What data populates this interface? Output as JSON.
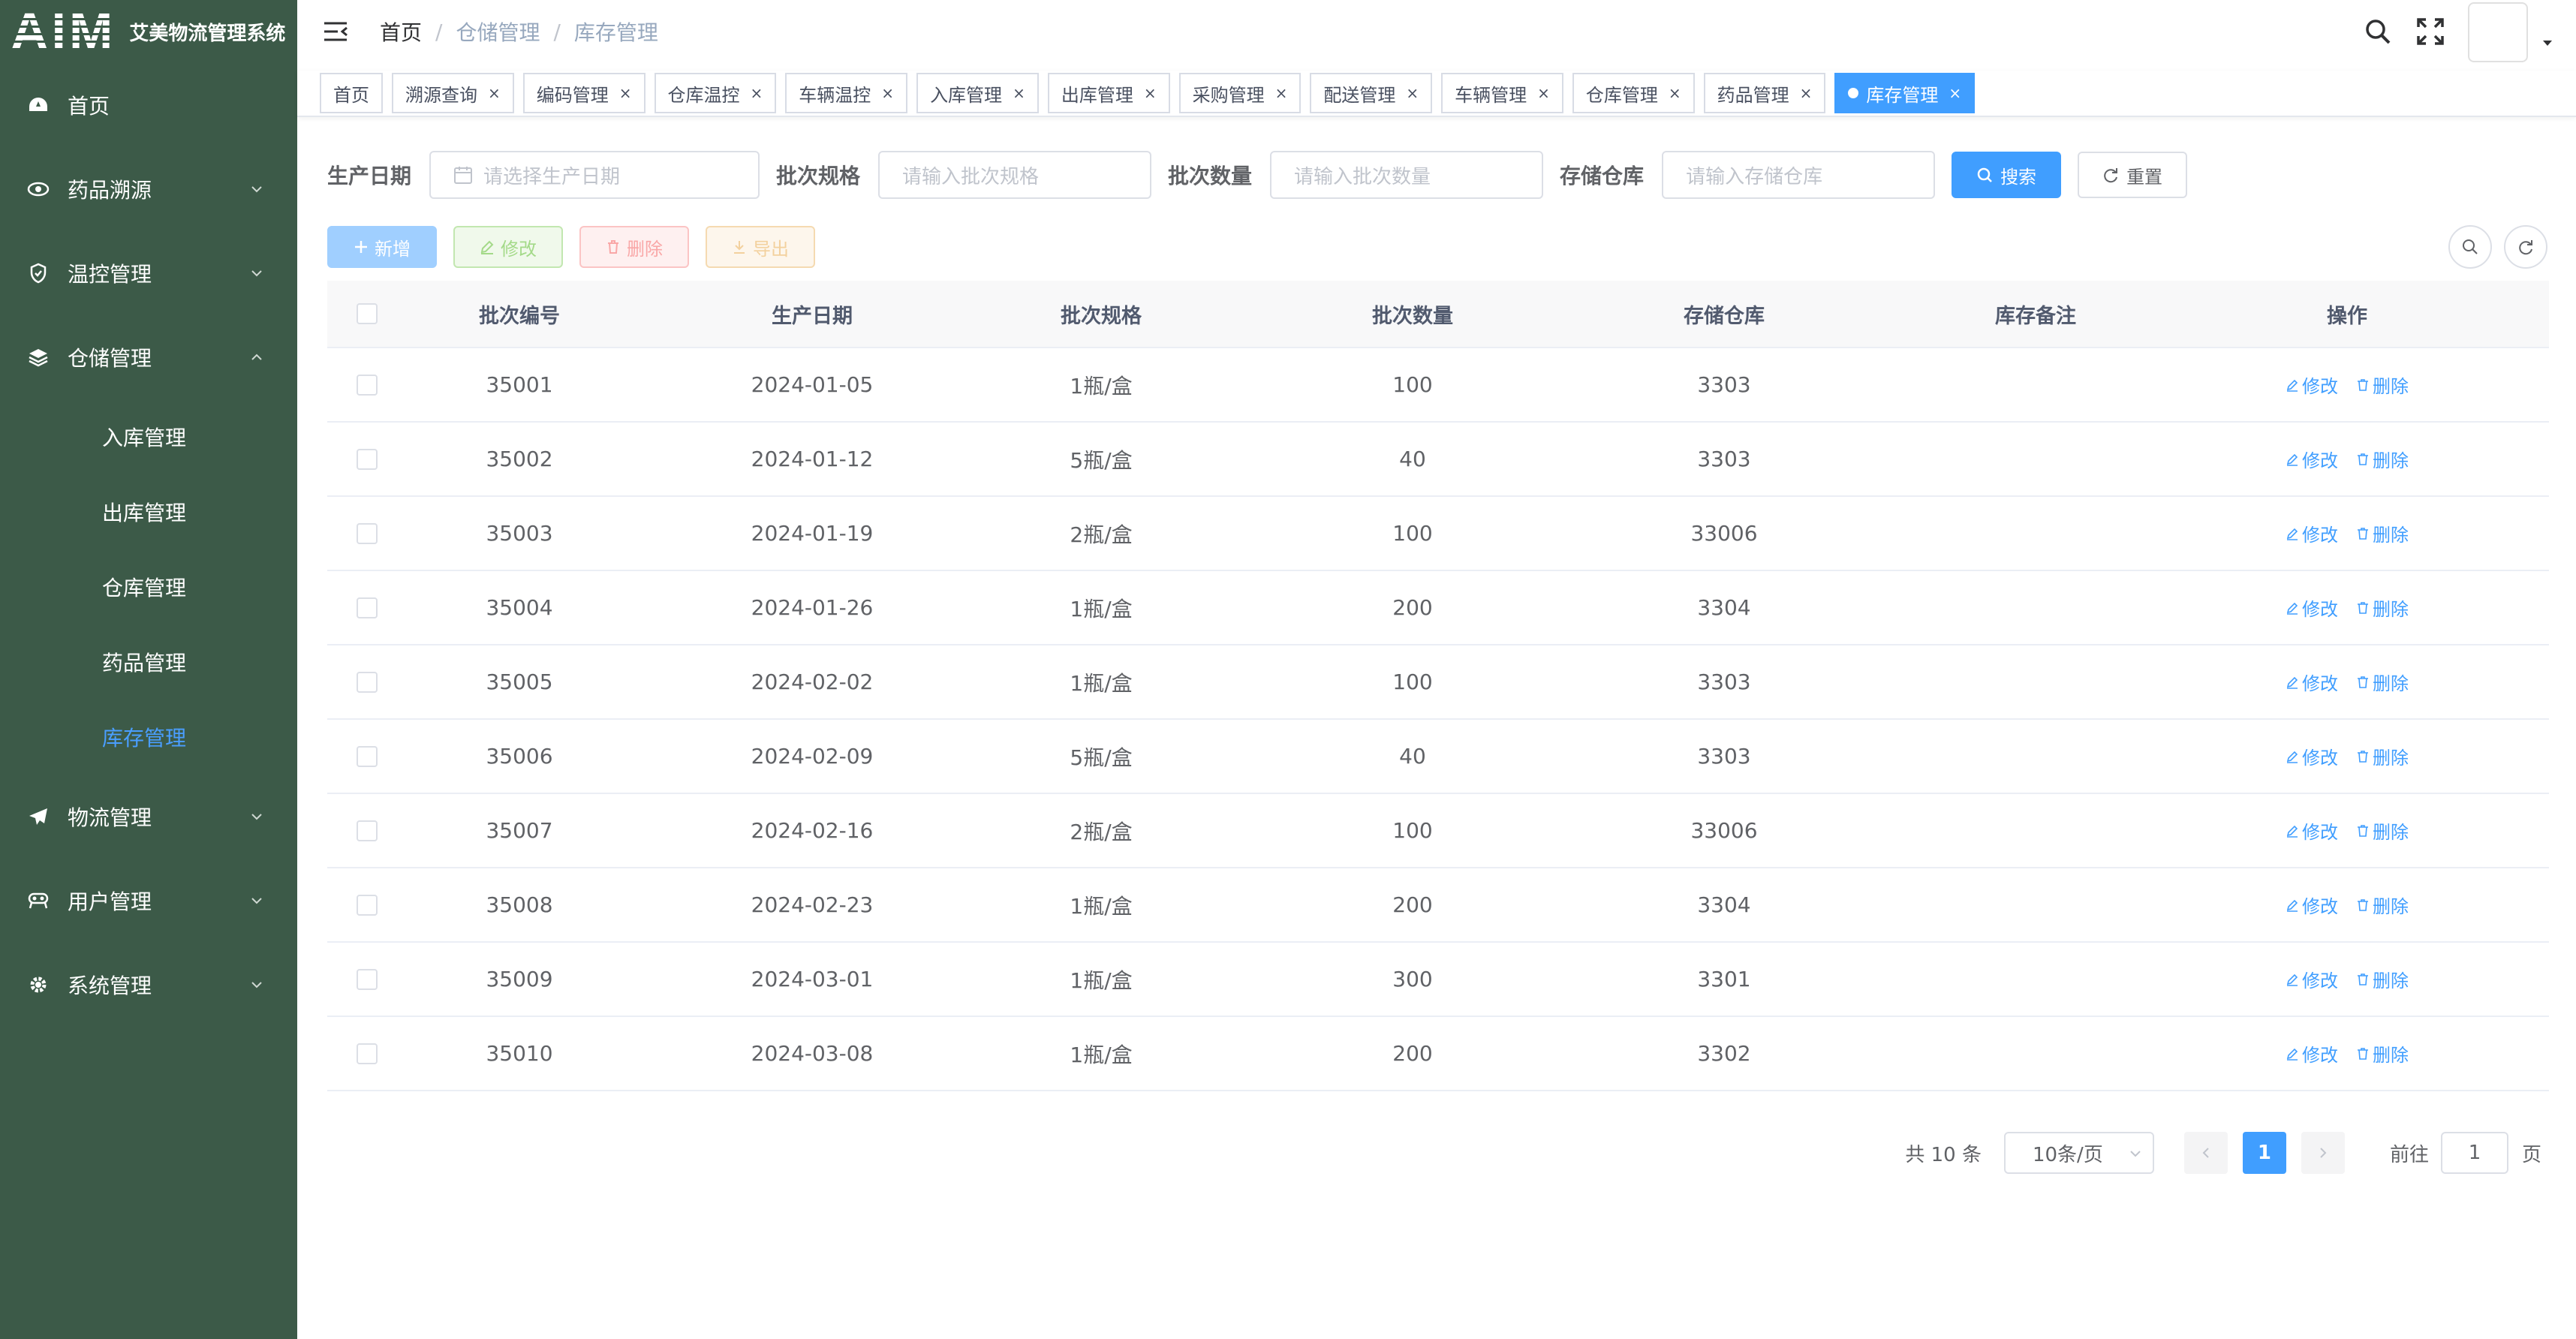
{
  "app": {
    "logo": "AIM",
    "title": "艾美物流管理系统"
  },
  "colors": {
    "sidebar": "#3c5a48",
    "primary": "#409eff",
    "active_menu_text": "#4a9eff"
  },
  "sidebar": {
    "items": [
      {
        "label": "首页",
        "icon": "dashboard-icon"
      },
      {
        "label": "药品溯源",
        "icon": "eye-icon"
      },
      {
        "label": "温控管理",
        "icon": "shield-icon"
      },
      {
        "label": "仓储管理",
        "icon": "layers-icon"
      },
      {
        "label": "物流管理",
        "icon": "paper-plane-icon"
      },
      {
        "label": "用户管理",
        "icon": "user-group-icon"
      },
      {
        "label": "系统管理",
        "icon": "gear-icon"
      }
    ],
    "sub_items": [
      "入库管理",
      "出库管理",
      "仓库管理",
      "药品管理",
      "库存管理"
    ],
    "active_sub": "库存管理"
  },
  "breadcrumb": [
    "首页",
    "仓储管理",
    "库存管理"
  ],
  "tags": [
    "首页",
    "溯源查询",
    "编码管理",
    "仓库温控",
    "车辆温控",
    "入库管理",
    "出库管理",
    "采购管理",
    "配送管理",
    "车辆管理",
    "仓库管理",
    "药品管理",
    "库存管理"
  ],
  "active_tag": "库存管理",
  "search": {
    "date_label": "生产日期",
    "date_placeholder": "请选择生产日期",
    "spec_label": "批次规格",
    "spec_placeholder": "请输入批次规格",
    "qty_label": "批次数量",
    "qty_placeholder": "请输入批次数量",
    "wh_label": "存储仓库",
    "wh_placeholder": "请输入存储仓库",
    "search_btn": "搜索",
    "reset_btn": "重置"
  },
  "toolbar": {
    "add": "新增",
    "edit": "修改",
    "delete": "删除",
    "export": "导出"
  },
  "table": {
    "headers": [
      "批次编号",
      "生产日期",
      "批次规格",
      "批次数量",
      "存储仓库",
      "库存备注",
      "操作"
    ],
    "rows": [
      [
        "35001",
        "2024-01-05",
        "1瓶/盒",
        "100",
        "3303",
        ""
      ],
      [
        "35002",
        "2024-01-12",
        "5瓶/盒",
        "40",
        "3303",
        ""
      ],
      [
        "35003",
        "2024-01-19",
        "2瓶/盒",
        "100",
        "33006",
        ""
      ],
      [
        "35004",
        "2024-01-26",
        "1瓶/盒",
        "200",
        "3304",
        ""
      ],
      [
        "35005",
        "2024-02-02",
        "1瓶/盒",
        "100",
        "3303",
        ""
      ],
      [
        "35006",
        "2024-02-09",
        "5瓶/盒",
        "40",
        "3303",
        ""
      ],
      [
        "35007",
        "2024-02-16",
        "2瓶/盒",
        "100",
        "33006",
        ""
      ],
      [
        "35008",
        "2024-02-23",
        "1瓶/盒",
        "200",
        "3304",
        ""
      ],
      [
        "35009",
        "2024-03-01",
        "1瓶/盒",
        "300",
        "3301",
        ""
      ],
      [
        "35010",
        "2024-03-08",
        "1瓶/盒",
        "200",
        "3302",
        ""
      ]
    ],
    "op_edit": "修改",
    "op_delete": "删除"
  },
  "pagination": {
    "total": "共 10 条",
    "page_size": "10条/页",
    "current": "1",
    "goto_prefix": "前往",
    "goto_value": "1",
    "goto_suffix": "页"
  }
}
